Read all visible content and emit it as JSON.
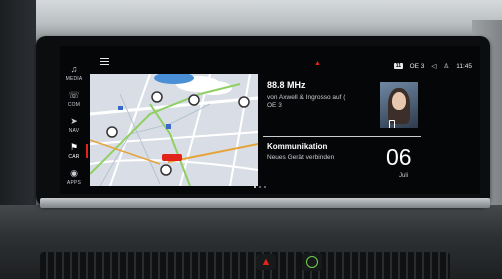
{
  "sidebar": {
    "items": [
      {
        "label": "MEDIA",
        "icon": "music-note-icon",
        "glyph": "♫"
      },
      {
        "label": "COM",
        "icon": "phone-icon",
        "glyph": "☏"
      },
      {
        "label": "NAV",
        "icon": "navigation-icon",
        "glyph": "➤"
      },
      {
        "label": "CAR",
        "icon": "car-icon",
        "glyph": "⚑"
      },
      {
        "label": "APPS",
        "icon": "apps-icon",
        "glyph": "◉"
      }
    ],
    "active": "CAR"
  },
  "status_bar": {
    "channel_badge": "11",
    "station_short": "OE 3",
    "time": "11:45"
  },
  "radio": {
    "frequency": "88.8 MHz",
    "station_line1": "von Axwell & Ingrosso auf (",
    "station_line2": "OE 3"
  },
  "communication": {
    "title": "Kommunikation",
    "subtitle": "Neues Gerät verbinden",
    "day": "06",
    "month": "Juli"
  },
  "colors": {
    "accent": "#e2231a",
    "screen_bg": "#050608",
    "text_primary": "#ffffff",
    "text_secondary": "#c8ccd0",
    "map_bg": "#d9dee6",
    "assist_green": "#6fd14a"
  }
}
